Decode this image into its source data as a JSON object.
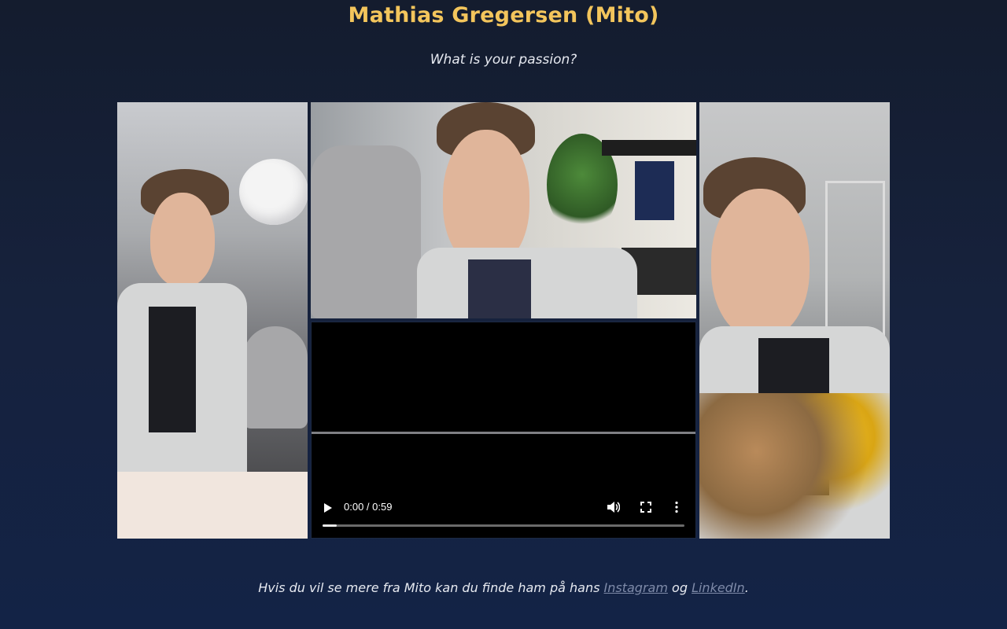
{
  "header": {
    "title": "Mathias Gregersen (Mito)",
    "subtitle": "What is your passion?"
  },
  "gallery": {
    "photos": [
      {
        "icon": "photo-playing-piano"
      },
      {
        "icon": "photo-portrait-desk"
      },
      {
        "icon": "photo-holding-flowers"
      }
    ]
  },
  "video": {
    "time_display": "0:00 / 0:59",
    "progress": 0.04
  },
  "footer": {
    "text_before": "Hvis du vil se mere fra Mito kan du finde ham på hans ",
    "instagram_label": "Instagram",
    "text_between": " og ",
    "linkedin_label": "LinkedIn",
    "text_after": "."
  },
  "colors": {
    "title": "#f3c55c",
    "link": "#7e8aa8",
    "background_top": "#141c2e",
    "background_bottom": "#132346"
  }
}
